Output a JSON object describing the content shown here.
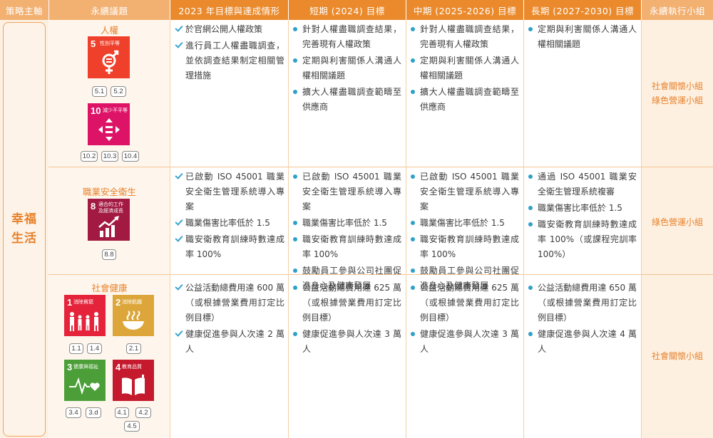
{
  "headers": {
    "pillar": "策略主軸",
    "issue": "永續議題",
    "y2023": "2023 年目標與達成情形",
    "short": "短期 (2024) 目標",
    "mid": "中期 (2025-2026) 目標",
    "long": "長期 (2027-2030) 目標",
    "team": "永續執行小組"
  },
  "pillar": "幸福生活",
  "colors": {
    "header_light": "#f2b071",
    "header_dark": "#ea8a2c",
    "accent": "#e8812b",
    "bullet": "#2fa0c8"
  },
  "rows": [
    {
      "issue": "人權",
      "sdgs": [
        {
          "num": "5",
          "label": "性別平等",
          "color": "#ef402b",
          "icon": "gender-equality-icon",
          "targets": [
            "5.1",
            "5.2"
          ]
        },
        {
          "num": "10",
          "label": "減少不平等",
          "color": "#dd1367",
          "icon": "reduced-inequalities-icon",
          "targets": [
            "10.2",
            "10.3",
            "10.4"
          ]
        }
      ],
      "y2023": [
        "於官網公開人權政策",
        "進行員工人權盡職調查，並依調查結果制定相關管理措施"
      ],
      "short": [
        "針對人權盡職調查結果，完善現有人權政策",
        "定期與利害關係人溝通人權相關議題",
        "擴大人權盡職調查範疇至供應商"
      ],
      "mid": [
        "針對人權盡職調查結果，完善現有人權政策",
        "定期與利害關係人溝通人權相關議題",
        "擴大人權盡職調查範疇至供應商"
      ],
      "long": [
        "定期與利害關係人溝通人權相關議題"
      ],
      "team": [
        "社會關懷小組",
        "綠色營運小組"
      ]
    },
    {
      "issue": "職業安全衛生",
      "sdgs": [
        {
          "num": "8",
          "label1": "適合的工作",
          "label2": "及經濟成長",
          "color": "#a21942",
          "icon": "decent-work-icon",
          "targets": [
            "8.8"
          ]
        }
      ],
      "y2023": [
        "已啟動 ISO 45001 職業安全衛生管理系統導入專案",
        "職業傷害比率低於 1.5",
        "職安衛教育訓練時數達成率 100%"
      ],
      "short": [
        "已啟動 ISO 45001 職業安全衛生管理系統導入專案",
        "職業傷害比率低於 1.5",
        "職安衛教育訓練時數達成率 100%",
        "鼓勵員工參與公司社團促進身心及健康發展"
      ],
      "mid": [
        "已啟動 ISO 45001 職業安全衛生管理系統導入專案",
        "職業傷害比率低於 1.5",
        "職安衛教育訓練時數達成率 100%",
        "鼓勵員工參與公司社團促進身心及健康發展"
      ],
      "long": [
        "通過 ISO 45001 職業安全衛生管理系統複審",
        "職業傷害比率低於 1.5",
        "職安衛教育訓練時數達成率 100%（或課程完訓率 100%）"
      ],
      "team": [
        "綠色營運小組"
      ]
    },
    {
      "issue": "社會健康",
      "sdgs": [
        {
          "num": "1",
          "label": "消除貧窮",
          "color": "#e5243b",
          "icon": "no-poverty-icon"
        },
        {
          "num": "2",
          "label": "消除飢餓",
          "color": "#dda63a",
          "icon": "zero-hunger-icon"
        },
        {
          "num": "3",
          "label": "健康與福祉",
          "color": "#4c9f38",
          "icon": "good-health-icon"
        },
        {
          "num": "4",
          "label": "教育品質",
          "color": "#c5192d",
          "icon": "quality-education-icon"
        }
      ],
      "targets": {
        "sdg1": [
          "1.1",
          "1.4"
        ],
        "sdg2": [
          "2.1"
        ],
        "sdg3": [
          "3.4",
          "3.d"
        ],
        "sdg4": [
          "4.1",
          "4.2",
          "4.5"
        ]
      },
      "y2023": [
        "公益活動總費用達 600 萬（或根據營業費用訂定比例目標）",
        "健康促進參與人次達 2 萬人"
      ],
      "short": [
        "公益活動總費用達 625 萬（或根據營業費用訂定比例目標）",
        "健康促進參與人次達 3 萬人"
      ],
      "mid": [
        "公益活動總費用達 625 萬（或根據營業費用訂定比例目標）",
        "健康促進參與人次達 3 萬人"
      ],
      "long": [
        "公益活動總費用達 650 萬（或根據營業費用訂定比例目標）",
        "健康促進參與人次達 4 萬人"
      ],
      "team": [
        "社會關懷小組"
      ]
    }
  ]
}
